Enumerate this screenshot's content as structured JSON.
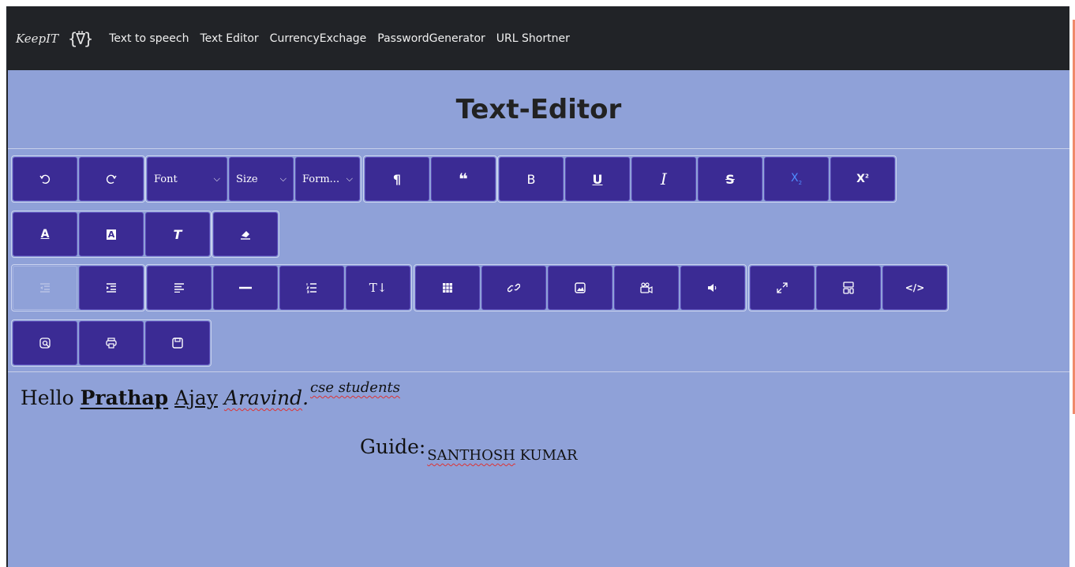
{
  "navbar": {
    "brand": "KeepIT",
    "links": [
      "Text to speech",
      "Text Editor",
      "CurrencyExchage",
      "PasswordGenerator",
      "URL Shortner"
    ]
  },
  "page": {
    "title": "Text-Editor"
  },
  "toolbar": {
    "font_label": "Font",
    "size_label": "Size",
    "format_label": "Form...",
    "bold_label": "B",
    "underline_label": "U",
    "italic_label": "I",
    "subscript_label": "X",
    "superscript_label": "X",
    "text_dir_label": "T↓"
  },
  "editor": {
    "hello": "Hello",
    "name_bold": "Prathap",
    "name_underlined": "Ajay",
    "name_italic": "Aravind",
    "period": ".",
    "superscript": "cse students",
    "guide_label": "Guide:",
    "guide_sub_first": "SANTHOSH",
    "guide_sub_rest": "KUMAR"
  },
  "colors": {
    "background": "#8fa1d8",
    "button": "#3b2b94",
    "navbar": "#212327",
    "subscript_icon": "#4f8cff"
  }
}
